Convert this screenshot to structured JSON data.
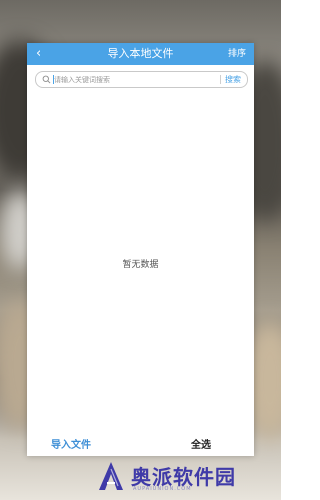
{
  "header": {
    "back_icon": "chevron-left-icon",
    "title": "导入本地文件",
    "sort_label": "排序"
  },
  "search": {
    "icon": "search-icon",
    "placeholder": "请输入关键词搜索",
    "value": "",
    "button_label": "搜索"
  },
  "content": {
    "empty_text": "暂无数据"
  },
  "footer": {
    "import_label": "导入文件",
    "select_all_label": "全选"
  },
  "watermark": {
    "text": "奥派软件园",
    "subtext": "AUPAIUNION.COM"
  },
  "colors": {
    "accent": "#4aa3e6",
    "import_text": "#3e8fd6",
    "watermark": "#3f3aa8"
  }
}
